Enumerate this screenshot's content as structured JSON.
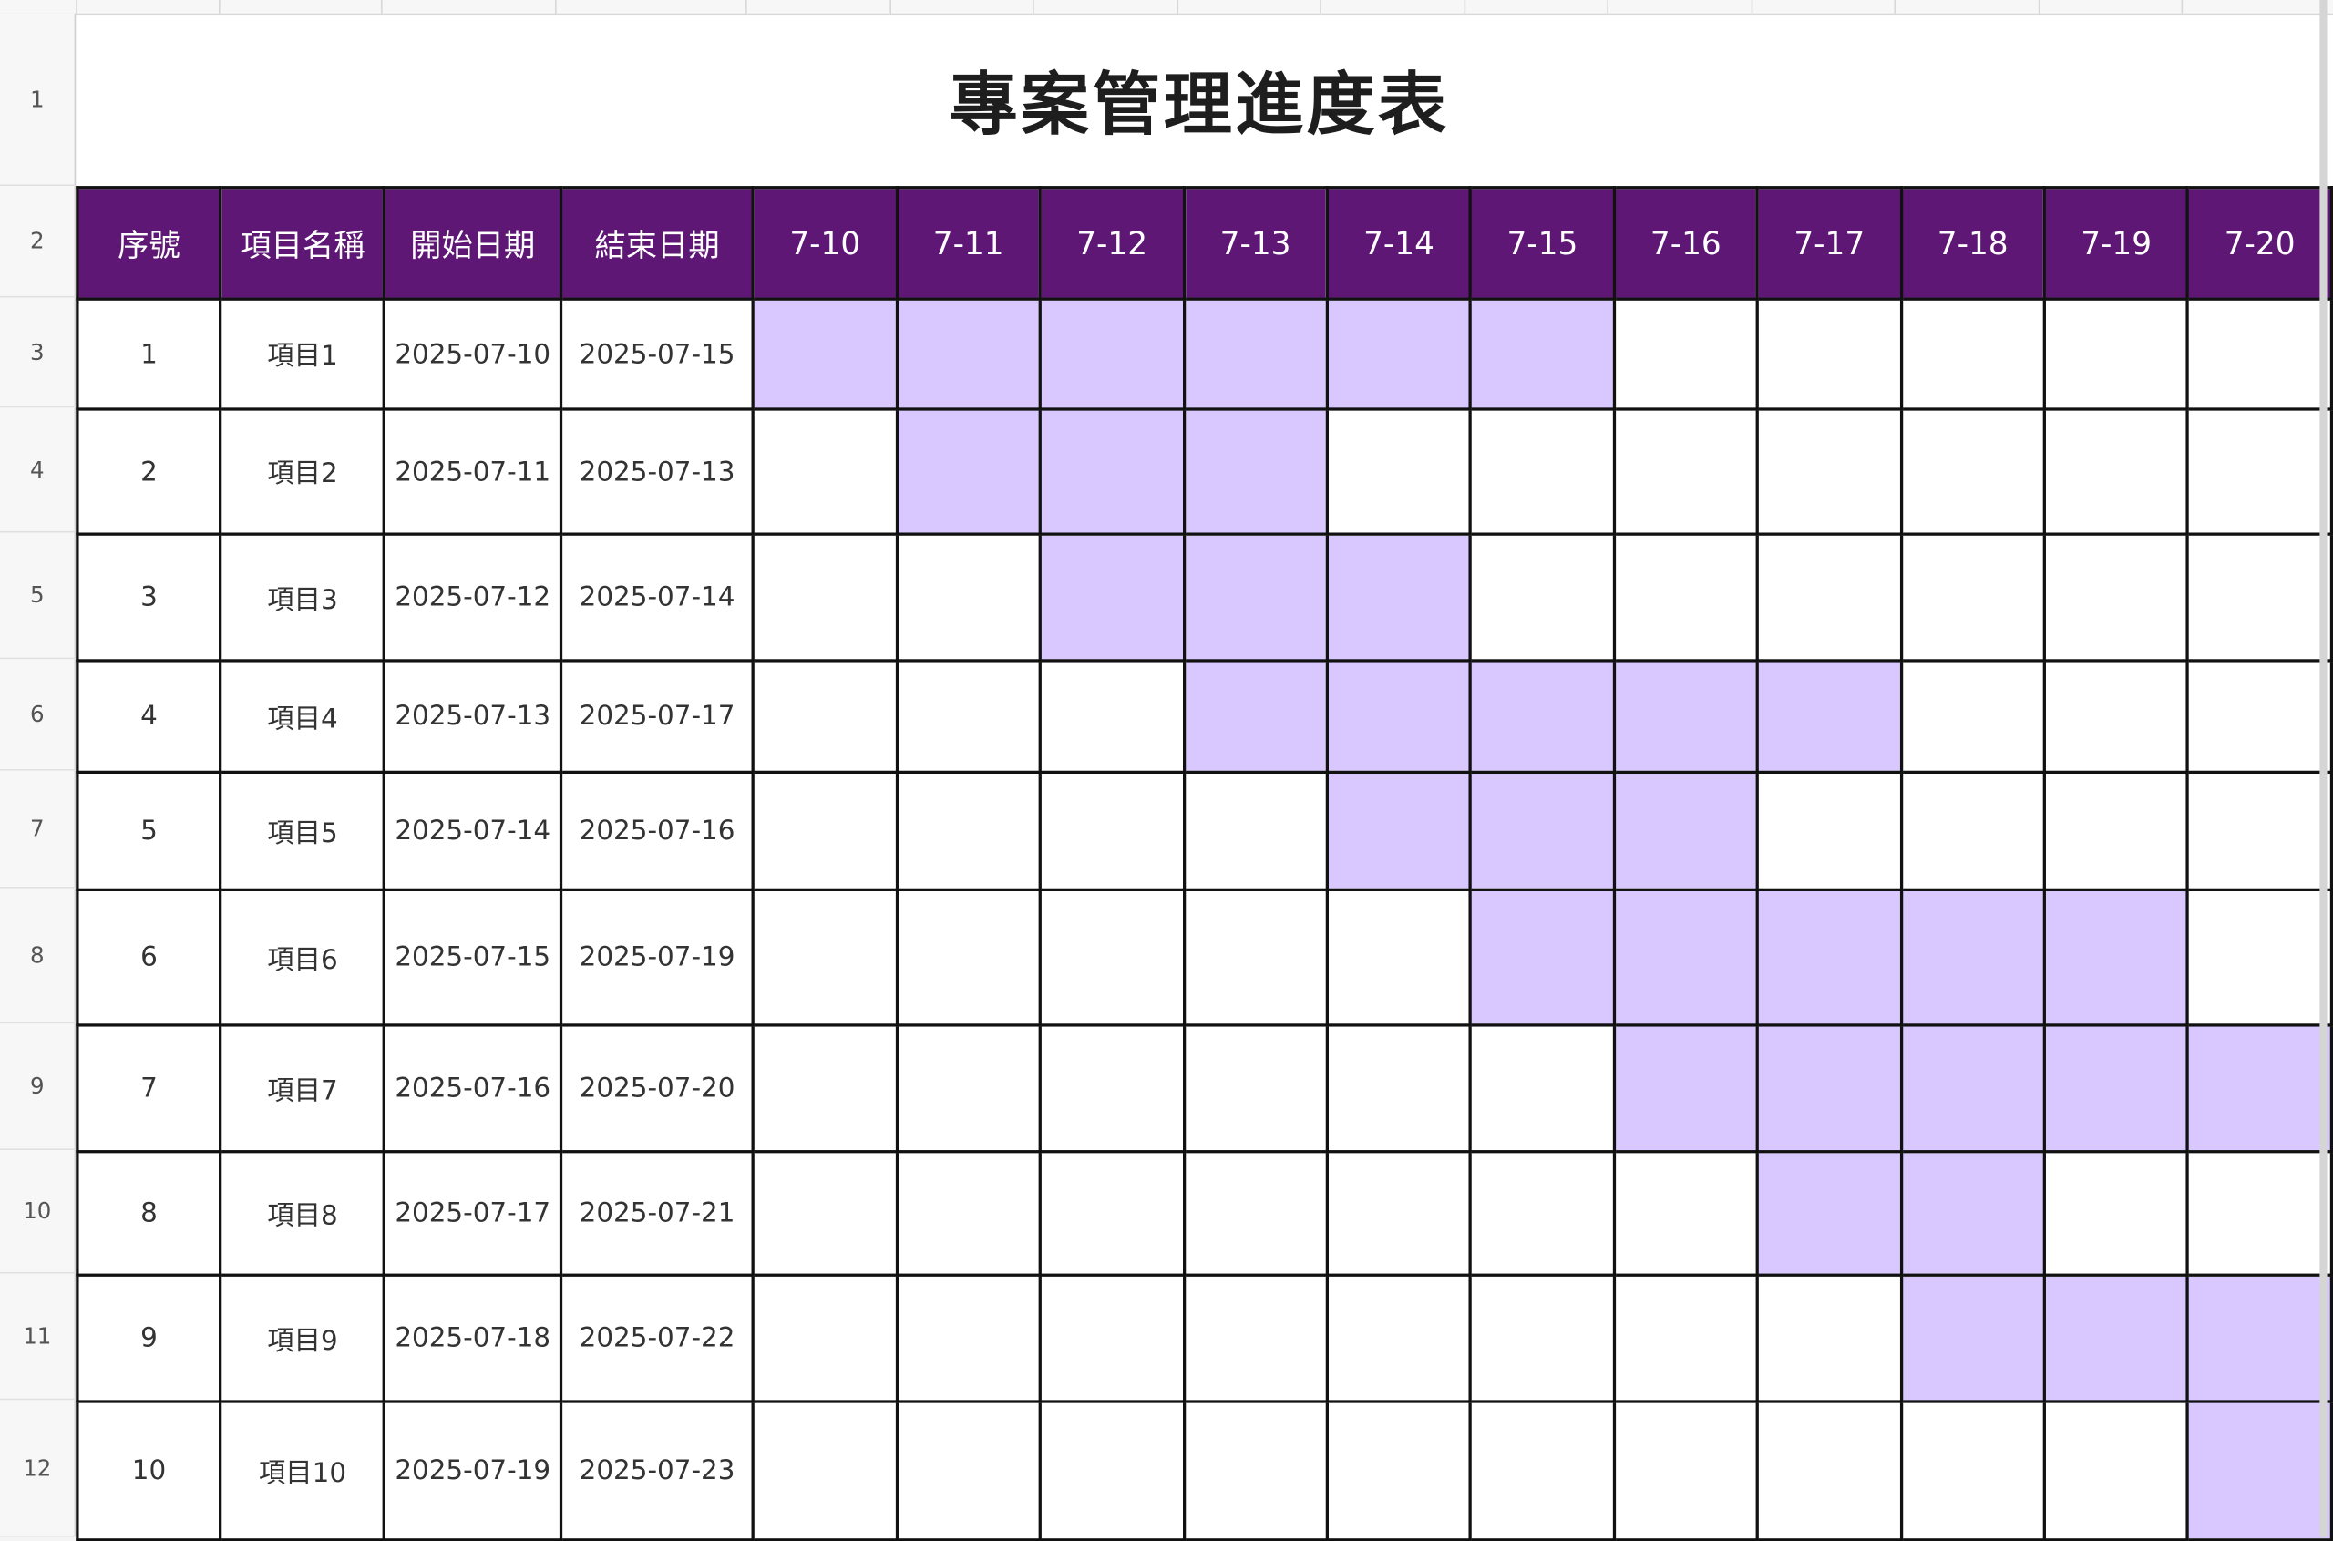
{
  "sheet": {
    "title": "專案管理進度表",
    "row_numbers": [
      "1",
      "2",
      "3",
      "4",
      "5",
      "6",
      "7",
      "8",
      "9",
      "10",
      "11",
      "12"
    ],
    "headers": {
      "seq": "序號",
      "name": "項目名稱",
      "start": "開始日期",
      "end": "結束日期"
    },
    "date_columns": [
      "7-10",
      "7-11",
      "7-12",
      "7-13",
      "7-14",
      "7-15",
      "7-16",
      "7-17",
      "7-18",
      "7-19",
      "7-20"
    ],
    "tasks": [
      {
        "seq": "1",
        "name": "項目1",
        "start": "2025-07-10",
        "end": "2025-07-15",
        "bar_start": 0,
        "bar_end": 5
      },
      {
        "seq": "2",
        "name": "項目2",
        "start": "2025-07-11",
        "end": "2025-07-13",
        "bar_start": 1,
        "bar_end": 3
      },
      {
        "seq": "3",
        "name": "項目3",
        "start": "2025-07-12",
        "end": "2025-07-14",
        "bar_start": 2,
        "bar_end": 4
      },
      {
        "seq": "4",
        "name": "項目4",
        "start": "2025-07-13",
        "end": "2025-07-17",
        "bar_start": 3,
        "bar_end": 7
      },
      {
        "seq": "5",
        "name": "項目5",
        "start": "2025-07-14",
        "end": "2025-07-16",
        "bar_start": 4,
        "bar_end": 6
      },
      {
        "seq": "6",
        "name": "項目6",
        "start": "2025-07-15",
        "end": "2025-07-19",
        "bar_start": 5,
        "bar_end": 9
      },
      {
        "seq": "7",
        "name": "項目7",
        "start": "2025-07-16",
        "end": "2025-07-20",
        "bar_start": 6,
        "bar_end": 10
      },
      {
        "seq": "8",
        "name": "項目8",
        "start": "2025-07-17",
        "end": "2025-07-21",
        "bar_start": 7,
        "bar_end": 8
      },
      {
        "seq": "9",
        "name": "項目9",
        "start": "2025-07-18",
        "end": "2025-07-22",
        "bar_start": 8,
        "bar_end": 10
      },
      {
        "seq": "10",
        "name": "項目10",
        "start": "2025-07-19",
        "end": "2025-07-23",
        "bar_start": 10,
        "bar_end": 10
      }
    ]
  },
  "colors": {
    "header_bg": "#5f1776",
    "bar_fill": "#d8c8ff",
    "grid": "#111111"
  }
}
